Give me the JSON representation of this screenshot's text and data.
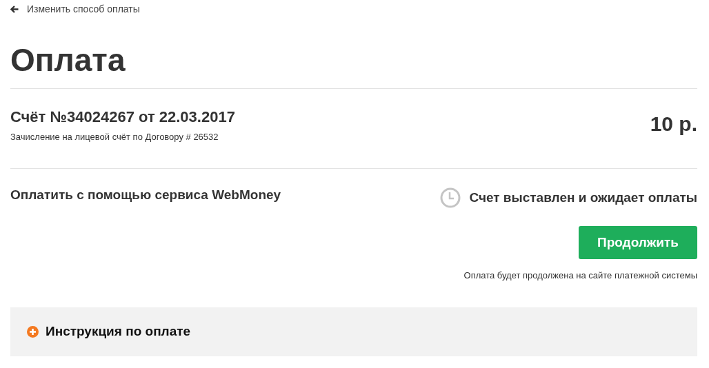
{
  "back_link": {
    "label": "Изменить способ оплаты"
  },
  "title": "Оплата",
  "invoice": {
    "title": "Счёт №34024267 от 22.03.2017",
    "description": "Зачисление на лицевой счёт по Договору # 26532",
    "amount": "10 р."
  },
  "payment": {
    "method": "Оплатить с помощью сервиса WebMoney",
    "status": "Счет выставлен и ожидает оплаты",
    "button": "Продолжить",
    "note": "Оплата будет продолжена на сайте платежной системы"
  },
  "instructions": {
    "label": "Инструкция по оплате",
    "expanded": false
  }
}
